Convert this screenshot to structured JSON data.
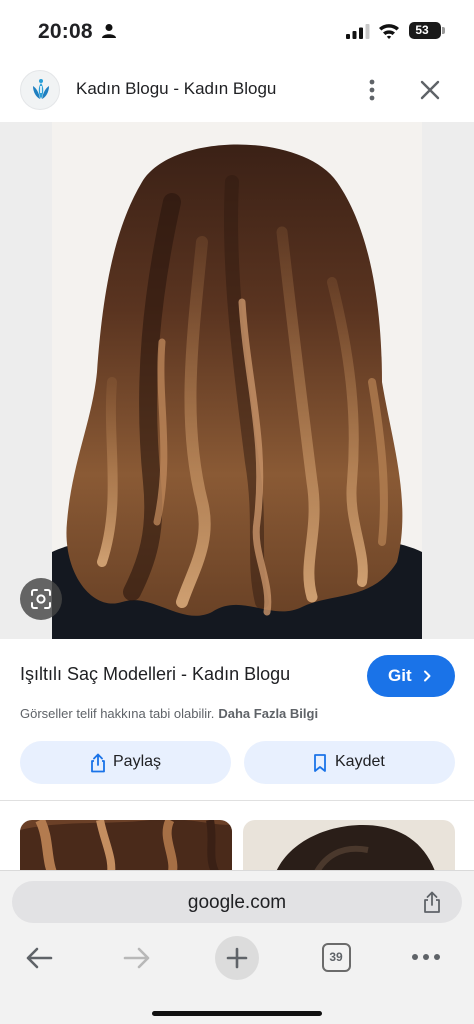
{
  "status_bar": {
    "time": "20:08",
    "battery": "53",
    "icons": [
      "person-icon",
      "signal-icon",
      "wifi-icon",
      "battery-icon"
    ]
  },
  "header": {
    "logo_icon": "kadin-blogu-logo",
    "title": "Kadın Blogu - Kadın Blogu",
    "more_icon": "more-vertical-icon",
    "close_icon": "close-icon"
  },
  "image": {
    "lens_icon": "google-lens-icon"
  },
  "result": {
    "title": "Işıltılı Saç Modelleri - Kadın Blogu",
    "go_label": "Git",
    "copyright_note": "Görseller telif hakkına tabi olabilir.",
    "more_info": "Daha Fazla Bilgi"
  },
  "actions": {
    "share_label": "Paylaş",
    "save_label": "Kaydet"
  },
  "browser": {
    "address": "google.com",
    "tab_count": "39"
  },
  "colors": {
    "accent": "#1a73e8",
    "pill_bg": "#e8f0fe",
    "toolbar_bg": "#f2f2f2"
  }
}
